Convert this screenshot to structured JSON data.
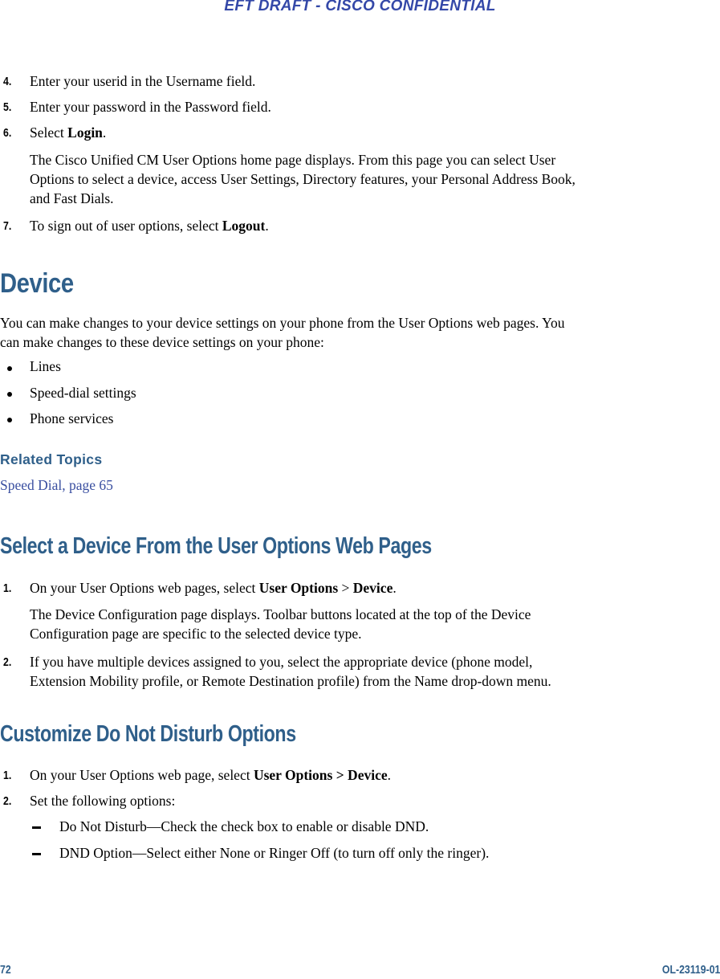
{
  "header": {
    "banner": "EFT DRAFT - CISCO CONFIDENTIAL"
  },
  "login_steps": [
    {
      "num": "4.",
      "text": "Enter your userid in the Username field."
    },
    {
      "num": "5.",
      "text": "Enter your password in the Password field."
    },
    {
      "num": "6.",
      "prefix": "Select ",
      "bold": "Login",
      "suffix": "."
    },
    {
      "num": "7.",
      "prefix": "To sign out of user options, select ",
      "bold": "Logout",
      "suffix": "."
    }
  ],
  "login_note": {
    "line1": "The Cisco Unified CM User Options home page displays. From this page you can select User",
    "line2": "Options to select a device, access User Settings, Directory features, your Personal Address Book,",
    "line3": "and Fast Dials."
  },
  "device": {
    "heading": "Device",
    "intro_line1": "You can make changes to your device settings on your phone from the User Options web pages. You",
    "intro_line2": "can make changes to these device settings on your phone:",
    "bullets": [
      "Lines",
      "Speed-dial settings",
      "Phone services"
    ],
    "related_heading": "Related Topics",
    "related_link": "Speed Dial, page 65"
  },
  "select_device": {
    "heading": "Select a Device From the User Options Web Pages",
    "step1": {
      "num": "1.",
      "prefix": "On your User Options web pages, select ",
      "bold1": "User Options",
      "sep": " > ",
      "bold2": "Device",
      "suffix": "."
    },
    "step1_note_line1": "The Device Configuration page displays. Toolbar buttons located at the top of the Device",
    "step1_note_line2": "Configuration page are specific to the selected device type.",
    "step2": {
      "num": "2.",
      "line1": "If you have multiple devices assigned to you, select the appropriate device (phone model,",
      "line2": "Extension Mobility profile, or Remote Destination profile) from the Name drop-down menu."
    }
  },
  "dnd": {
    "heading": "Customize Do Not Disturb Options",
    "step1": {
      "num": "1.",
      "prefix": "On your User Options web page, select ",
      "bold": "User Options > Device",
      "suffix": "."
    },
    "step2": {
      "num": "2.",
      "text": "Set the following options:"
    },
    "options": [
      "Do Not Disturb—Check the check box to enable or disable DND.",
      "DND Option—Select either None or Ringer Off (to turn off only the ringer)."
    ]
  },
  "footer": {
    "page_number": "72",
    "doc_id": "OL-23119-01"
  }
}
